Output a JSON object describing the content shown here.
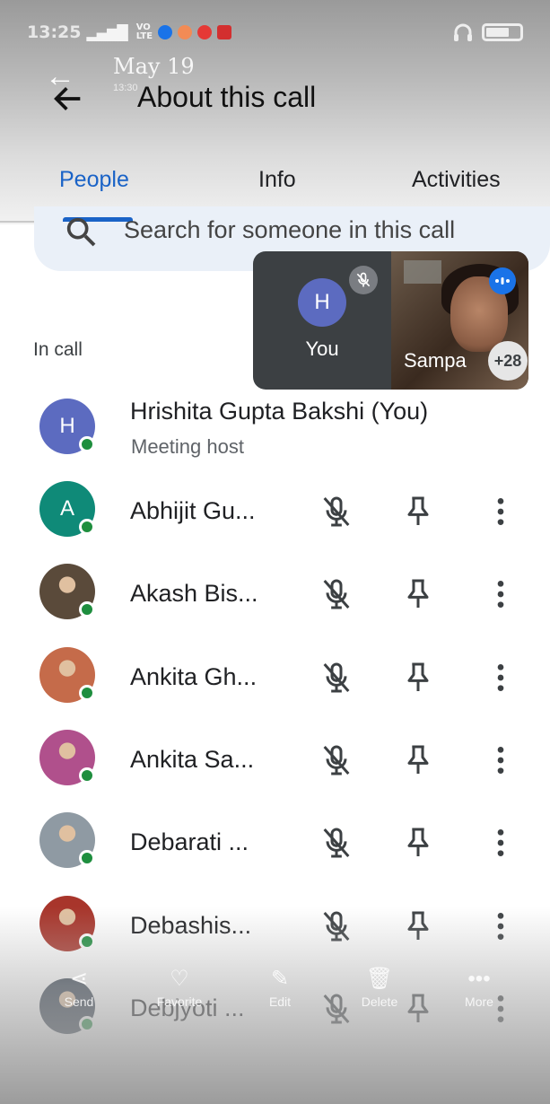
{
  "status_bar": {
    "time": "13:25",
    "network_top": "VO",
    "network_bottom": "LTE",
    "app_dot_colors": [
      "#1a73e8",
      "#f28b55",
      "#e53935",
      "#d32f2f"
    ]
  },
  "ghost_overlay": {
    "date": "May 19",
    "time_small": "13:30"
  },
  "header": {
    "title": "About this call"
  },
  "tabs": [
    {
      "label": "People",
      "active": true
    },
    {
      "label": "Info",
      "active": false
    },
    {
      "label": "Activities",
      "active": false
    }
  ],
  "search": {
    "placeholder": "Search for someone in this call"
  },
  "in_call_label": "In call",
  "pip": {
    "you_initial": "H",
    "you_label": "You",
    "other_name": "Sampa",
    "extra_count": "+28"
  },
  "host": {
    "initial": "H",
    "name": "Hrishita Gupta Bakshi (You)",
    "role": "Meeting host",
    "avatar_color": "#5c6bc0"
  },
  "participants": [
    {
      "name": "Abhijit Gu...",
      "initial": "A",
      "avatar_color": "#0f8a78"
    },
    {
      "name": "Akash Bis...",
      "initial": "",
      "avatar_color": "#5a4a3a"
    },
    {
      "name": "Ankita Gh...",
      "initial": "",
      "avatar_color": "#c56b4a"
    },
    {
      "name": "Ankita Sa...",
      "initial": "",
      "avatar_color": "#b0508c"
    },
    {
      "name": "Debarati ...",
      "initial": "",
      "avatar_color": "#8f9aa3"
    },
    {
      "name": "Debashis...",
      "initial": "",
      "avatar_color": "#a8352b"
    },
    {
      "name": "Debjyoti ...",
      "initial": "",
      "avatar_color": "#2f3b4a"
    }
  ],
  "gallery_bar": {
    "items": [
      "Send",
      "Favorite",
      "Edit",
      "Delete",
      "More"
    ]
  },
  "colors": {
    "accent": "#1a63c7",
    "online": "#1e8e3e",
    "icon": "#3c4043"
  }
}
